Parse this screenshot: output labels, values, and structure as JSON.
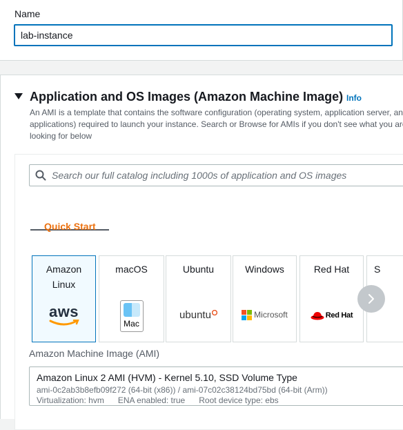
{
  "name_section": {
    "label": "Name",
    "value": "lab-instance"
  },
  "ami_section": {
    "title": "Application and OS Images (Amazon Machine Image)",
    "info_link": "Info",
    "description": "An AMI is a template that contains the software configuration (operating system, application server, and applications) required to launch your instance. Search or Browse for AMIs if you don't see what you are looking for below",
    "search": {
      "placeholder": "Search our full catalog including 1000s of application and OS images"
    },
    "tabs": [
      {
        "label": "Quick Start",
        "active": true
      }
    ],
    "os_cards": [
      {
        "label_line1": "Amazon",
        "label_line2": "Linux",
        "logo_text": "aws",
        "selected": true
      },
      {
        "label_line1": "macOS",
        "logo_text": "Mac",
        "selected": false
      },
      {
        "label_line1": "Ubuntu",
        "logo_text": "ubuntu",
        "selected": false
      },
      {
        "label_line1": "Windows",
        "logo_text": "Microsoft",
        "selected": false
      },
      {
        "label_line1": "Red Hat",
        "logo_text": "Red Hat",
        "selected": false
      },
      {
        "label_line1": "S"
      }
    ],
    "ami_field": {
      "label": "Amazon Machine Image (AMI)",
      "selected_title": "Amazon Linux 2 AMI (HVM) - Kernel 5.10, SSD Volume Type",
      "selected_ids": "ami-0c2ab3b8efb09f272 (64-bit (x86)) / ami-07c02c38124bd75bd (64-bit (Arm))",
      "selected_meta": "Virtualization: hvm      ENA enabled: true      Root device type: ebs"
    }
  },
  "colors": {
    "accent_blue": "#0073bb",
    "tab_orange": "#ec7211",
    "aws_orange": "#ff9900",
    "redhat_red": "#ee0000",
    "ubuntu_orange": "#e95420"
  }
}
